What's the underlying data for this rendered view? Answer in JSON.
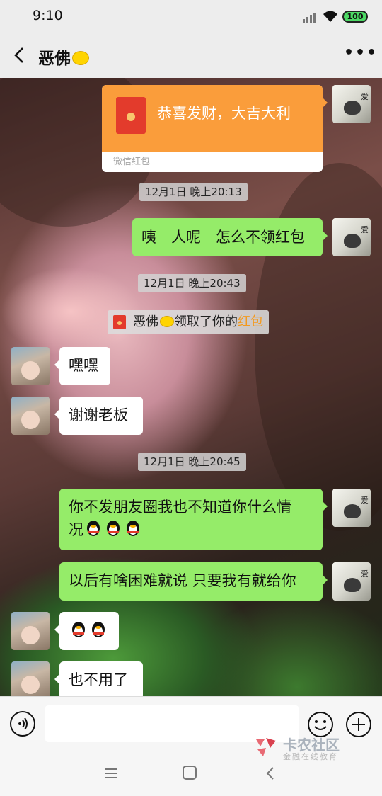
{
  "status_bar": {
    "time": "9:10",
    "battery": "100"
  },
  "header": {
    "title": "恶佛",
    "back_label": "back",
    "more_label": "•••"
  },
  "messages": {
    "red_packet": {
      "text": "恭喜发财，大吉大利",
      "footer": "微信红包"
    },
    "t1": "12月1日 晚上20:13",
    "m1": "咦　人呢　怎么不领红包",
    "t2": "12月1日 晚上20:43",
    "notice": {
      "name": "恶佛",
      "text": "领取了你的",
      "highlight": "红包"
    },
    "m2": "嘿嘿",
    "m3": "谢谢老板",
    "t3": "12月1日 晚上20:45",
    "m4_line1": "你不发朋友圈我也不知道你什么情",
    "m4_line2": "况",
    "m5": "以后有啥困难就说 只要我有就给你",
    "m7": "也不用了"
  },
  "input": {
    "placeholder": ""
  },
  "watermark": {
    "brand": "卡农社区",
    "sub": "金融在线教育"
  }
}
